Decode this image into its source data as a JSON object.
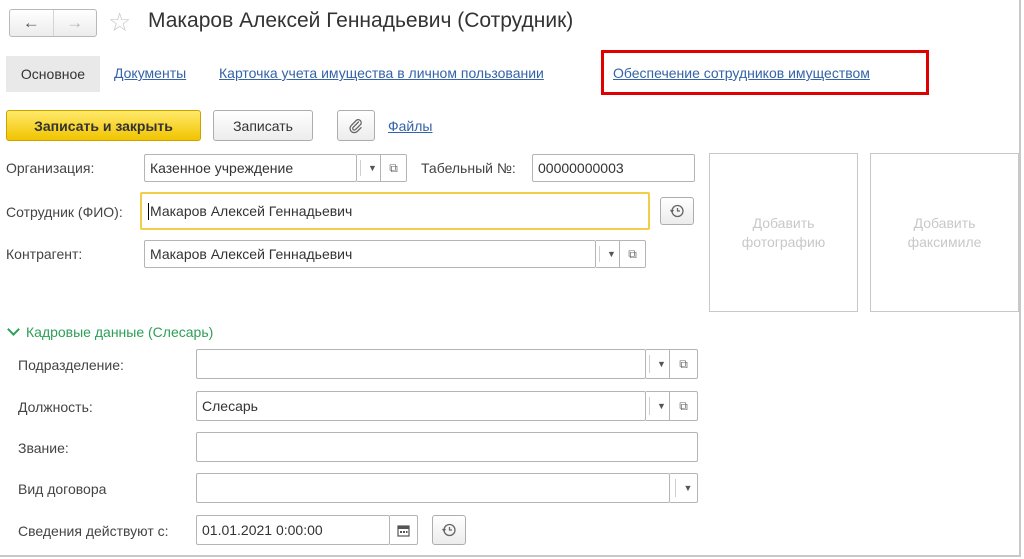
{
  "window": {
    "title": "Макаров Алексей Геннадьевич (Сотрудник)",
    "back_icon": "←",
    "forward_icon": "→",
    "star_icon": "☆"
  },
  "tabs": [
    {
      "label": "Основное"
    },
    {
      "label": "Документы"
    },
    {
      "label": "Карточка учета имущества в личном пользовании"
    },
    {
      "label": "Обеспечение сотрудников имуществом"
    }
  ],
  "toolbar": {
    "save_close_label": "Записать и закрыть",
    "save_label": "Записать",
    "files_label": "Файлы"
  },
  "form": {
    "organization_label": "Организация:",
    "organization_value": "Казенное учреждение",
    "tab_number_label": "Табельный №:",
    "tab_number_value": "00000000003",
    "employee_label": "Сотрудник (ФИО):",
    "employee_value": "Макаров Алексей Геннадьевич",
    "counterparty_label": "Контрагент:",
    "counterparty_value": "Макаров Алексей Геннадьевич"
  },
  "photo": {
    "add_photo": "Добавить фотографию",
    "add_facsimile": "Добавить факсимиле"
  },
  "hr": {
    "section_title": "Кадровые данные (Слесарь)",
    "department_label": "Подразделение:",
    "department_value": "",
    "position_label": "Должность:",
    "position_value": "Слесарь",
    "rank_label": "Звание:",
    "rank_value": "",
    "contract_label": "Вид договора",
    "contract_value": "",
    "effective_label": "Сведения действуют с:",
    "effective_value": "01.01.2021  0:00:00"
  },
  "colors": {
    "highlight": "#e00000",
    "primary_button": "#f1c400",
    "link": "#3463a8",
    "section": "#2c9f57"
  }
}
